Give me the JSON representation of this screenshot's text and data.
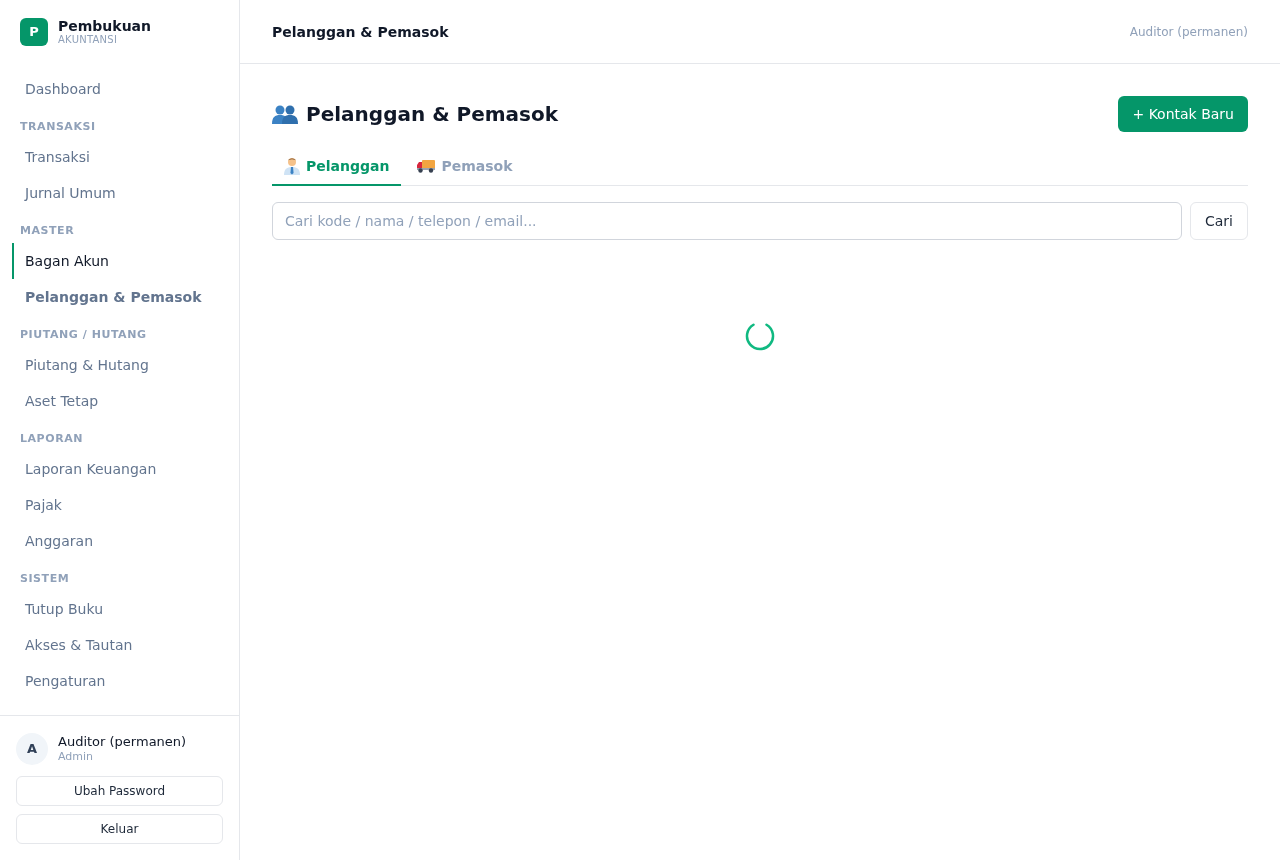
{
  "sidebar": {
    "brand": {
      "logo_letter": "P",
      "name": "Pembukuan",
      "subtitle": "AKUNTANSI"
    },
    "nav": [
      {
        "kind": "item",
        "label": "Dashboard",
        "selected": false,
        "hovered": false
      },
      {
        "kind": "section",
        "label": "TRANSAKSI"
      },
      {
        "kind": "item",
        "label": "Transaksi",
        "selected": false,
        "hovered": false
      },
      {
        "kind": "item",
        "label": "Jurnal Umum",
        "selected": false,
        "hovered": false
      },
      {
        "kind": "section",
        "label": "MASTER"
      },
      {
        "kind": "item",
        "label": "Bagan Akun",
        "selected": false,
        "hovered": true
      },
      {
        "kind": "item",
        "label": "Pelanggan & Pemasok",
        "selected": true,
        "hovered": false
      },
      {
        "kind": "section",
        "label": "PIUTANG / HUTANG"
      },
      {
        "kind": "item",
        "label": "Piutang & Hutang",
        "selected": false,
        "hovered": false
      },
      {
        "kind": "item",
        "label": "Aset Tetap",
        "selected": false,
        "hovered": false
      },
      {
        "kind": "section",
        "label": "LAPORAN"
      },
      {
        "kind": "item",
        "label": "Laporan Keuangan",
        "selected": false,
        "hovered": false
      },
      {
        "kind": "item",
        "label": "Pajak",
        "selected": false,
        "hovered": false
      },
      {
        "kind": "item",
        "label": "Anggaran",
        "selected": false,
        "hovered": false
      },
      {
        "kind": "section",
        "label": "SISTEM"
      },
      {
        "kind": "item",
        "label": "Tutup Buku",
        "selected": false,
        "hovered": false
      },
      {
        "kind": "item",
        "label": "Akses & Tautan",
        "selected": false,
        "hovered": false
      },
      {
        "kind": "item",
        "label": "Pengaturan",
        "selected": false,
        "hovered": false
      }
    ],
    "user": {
      "avatar_letter": "A",
      "name": "Auditor (permanen)",
      "role": "Admin"
    },
    "buttons": [
      "Ubah Password",
      "Keluar"
    ]
  },
  "topbar": {
    "title": "Pelanggan & Pemasok",
    "user": "Auditor (permanen)"
  },
  "page": {
    "title": "Pelanggan & Pemasok",
    "new_button": "+ Kontak Baru",
    "tabs": [
      {
        "label": "Pelanggan",
        "selected": true
      },
      {
        "label": "Pemasok",
        "selected": false
      }
    ],
    "search": {
      "placeholder": "Cari kode / nama / telepon / email...",
      "button": "Cari"
    },
    "loading": true
  }
}
